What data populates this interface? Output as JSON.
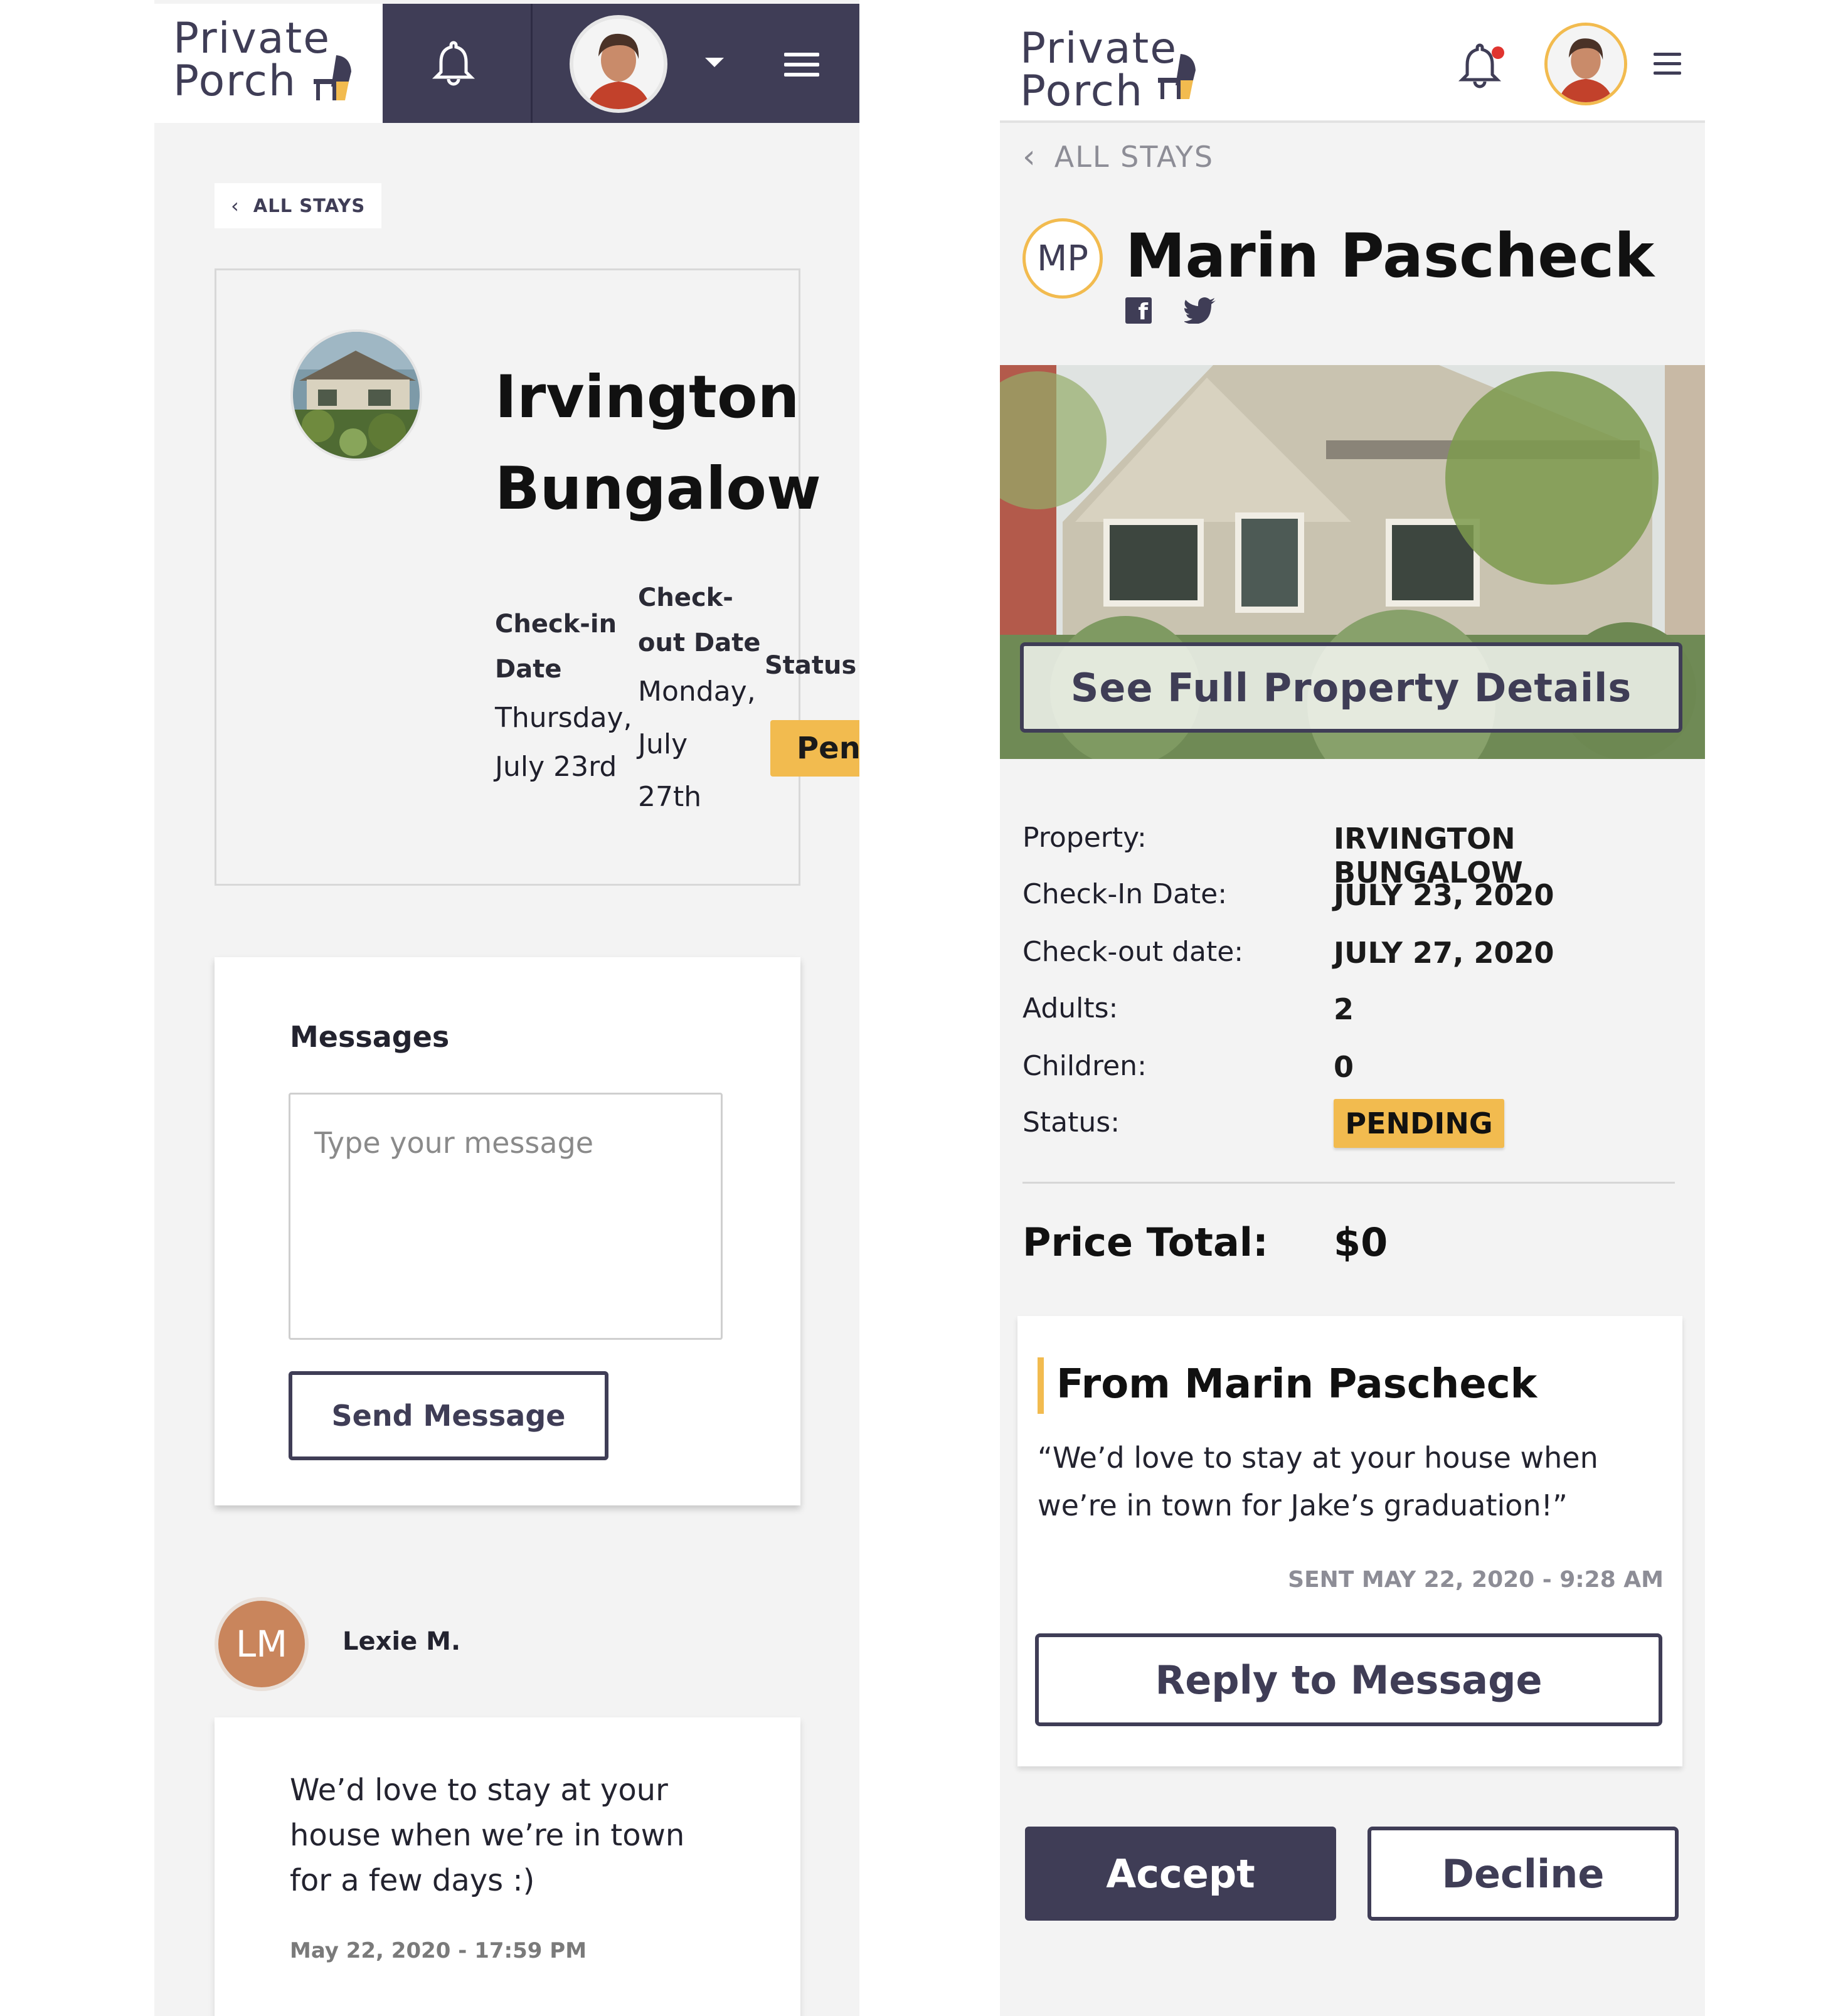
{
  "brand": {
    "line1": "Private",
    "line2": "Porch"
  },
  "left": {
    "back_label": "ALL STAYS",
    "stay": {
      "title_line1": "Irvington",
      "title_line2": "Bungalow",
      "checkin_label_1": "Check-in",
      "checkin_label_2": "Date",
      "checkin_val_1": "Thursday,",
      "checkin_val_2": "July 23rd",
      "checkout_label_1": "Check-",
      "checkout_label_2": "out Date",
      "checkout_val_1": "Monday,",
      "checkout_val_2": "July",
      "checkout_val_3": "27th",
      "status_label": "Status",
      "status_val": "Pen"
    },
    "messages": {
      "title": "Messages",
      "placeholder": "Type your message",
      "send_label": "Send Message"
    },
    "thread": {
      "initials": "LM",
      "name": "Lexie M.",
      "text": "We’d love to stay at your house when we’re in town for a few days :)",
      "time": "May 22, 2020 - 17:59 PM"
    }
  },
  "right": {
    "back_label": "ALL STAYS",
    "guest": {
      "initials": "MP",
      "name": "Marin Pascheck"
    },
    "details_button": "See Full Property Details",
    "fields": [
      {
        "label": "Property:",
        "value": "IRVINGTON BUNGALOW"
      },
      {
        "label": "Check-In Date:",
        "value": "JULY 23, 2020"
      },
      {
        "label": "Check-out date:",
        "value": "JULY 27, 2020"
      },
      {
        "label": "Adults:",
        "value": "2"
      },
      {
        "label": "Children:",
        "value": "0"
      },
      {
        "label": "Status:",
        "value": "PENDING"
      }
    ],
    "price_label": "Price Total:",
    "price_value": "$0",
    "from": {
      "title": "From Marin Pascheck",
      "quote": "“We’d love to stay at your house when we’re in town for Jake’s graduation!”",
      "sent": "SENT MAY 22, 2020 - 9:28 AM",
      "reply_label": "Reply to Message"
    },
    "accept_label": "Accept",
    "decline_label": "Decline"
  },
  "colors": {
    "navy": "#3f3d56",
    "accent": "#f2bb4f",
    "notification": "#e0342f",
    "avatar_lm": "#c9855c"
  },
  "icons": [
    "bell-icon",
    "caret-down-icon",
    "hamburger-menu-icon",
    "chevron-left-icon",
    "facebook-icon",
    "twitter-icon"
  ]
}
